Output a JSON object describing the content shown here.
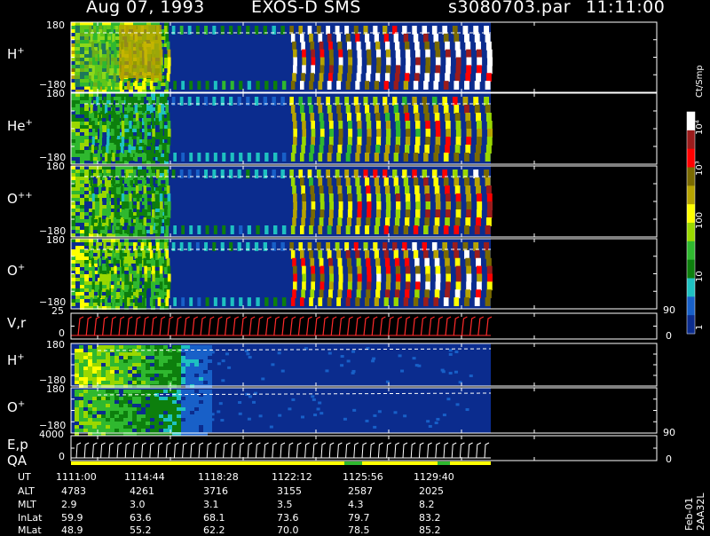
{
  "header": {
    "date": "Aug 07, 1993",
    "instrument": "EXOS-D SMS",
    "file": "s3080703.par",
    "time": "11:11:00"
  },
  "panels": [
    {
      "label": "H+",
      "top_tick": "180",
      "bottom_tick": "−180"
    },
    {
      "label": "He+",
      "top_tick": "180",
      "bottom_tick": "−180"
    },
    {
      "label": "O++",
      "top_tick": "180",
      "bottom_tick": "−180"
    },
    {
      "label": "O+",
      "top_tick": "180",
      "bottom_tick": "−180"
    },
    {
      "label": "V,r",
      "top_tick": "25",
      "bottom_tick": "0",
      "right_top": "90",
      "right_bottom": "0"
    },
    {
      "label": "H+",
      "top_tick": "180",
      "bottom_tick": "−180"
    },
    {
      "label": "O+",
      "top_tick": "180",
      "bottom_tick": "−180"
    },
    {
      "label": "E,p",
      "label2": "QA",
      "top_tick": "4000",
      "bottom_tick": "0",
      "right_top": "90",
      "right_bottom": "0"
    }
  ],
  "colorbar": {
    "title": "Ct/Smp",
    "labels": [
      "10⁴",
      "10³",
      "100",
      "10",
      "1"
    ],
    "colors": [
      "#ffffff",
      "#9b1c1c",
      "#ff0000",
      "#7a6a00",
      "#b6a300",
      "#ffff00",
      "#9ad800",
      "#2fb82f",
      "#0d7f0d",
      "#1ec1c1",
      "#1860c8",
      "#0b2c8e"
    ]
  },
  "footer": {
    "rows": [
      {
        "name": "UT",
        "values": [
          "1111:00",
          "1114:44",
          "1118:28",
          "1122:12",
          "1125:56",
          "1129:40"
        ]
      },
      {
        "name": "ALT",
        "values": [
          "4783",
          "4261",
          "3716",
          "3155",
          "2587",
          "2025"
        ]
      },
      {
        "name": "MLT",
        "values": [
          "2.9",
          "3.0",
          "3.1",
          "3.5",
          "4.3",
          "8.2"
        ]
      },
      {
        "name": "InLat",
        "values": [
          "59.9",
          "63.6",
          "68.1",
          "73.6",
          "79.7",
          "83.2"
        ]
      },
      {
        "name": "MLat",
        "values": [
          "48.9",
          "55.2",
          "62.2",
          "70.0",
          "78.5",
          "85.2"
        ]
      }
    ],
    "side_id": "Feb-01 2AA32L"
  },
  "chart_data": {
    "type": "heatmap",
    "title": "Aug 07, 1993   EXOS-D SMS",
    "x": [
      "1111:00",
      "1114:44",
      "1118:28",
      "1122:12",
      "1125:56",
      "1129:40"
    ],
    "panels": [
      {
        "name": "H+",
        "ylim": [
          -180,
          180
        ]
      },
      {
        "name": "He+",
        "ylim": [
          -180,
          180
        ]
      },
      {
        "name": "O++",
        "ylim": [
          -180,
          180
        ]
      },
      {
        "name": "O+",
        "ylim": [
          -180,
          180
        ]
      },
      {
        "name": "V,r",
        "ylim": [
          0,
          25
        ],
        "y2lim": [
          0,
          90
        ]
      },
      {
        "name": "H+",
        "ylim": [
          -180,
          180
        ]
      },
      {
        "name": "O+",
        "ylim": [
          -180,
          180
        ]
      },
      {
        "name": "E,p",
        "ylim": [
          0,
          4000
        ],
        "y2lim": [
          0,
          90
        ]
      }
    ],
    "colorbar": {
      "title": "Ct/Smp",
      "ticks": [
        "1",
        "10",
        "100",
        "10³",
        "10⁴"
      ]
    }
  }
}
